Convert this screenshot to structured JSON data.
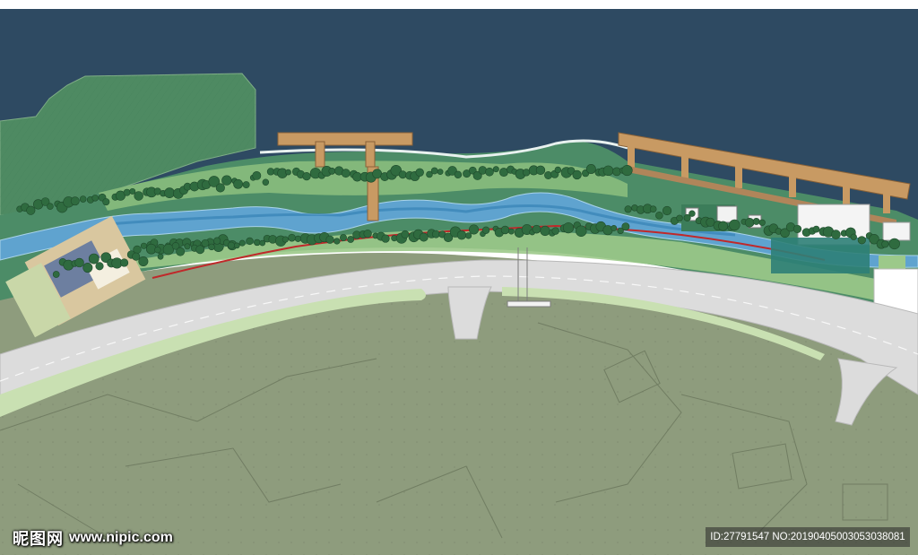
{
  "watermark": {
    "brand": "昵图网",
    "url": "www.nipic.com",
    "id_text": "ID:27791547 NO:20190405003053038081"
  },
  "colors": {
    "water": "#2e4a62",
    "land": "#8e9c7d",
    "park_dark": "#4c8c67",
    "park_light": "#8dbf7f",
    "road": "#dcdcdc",
    "stream": "#5fa3cf",
    "timber": "#c89a63",
    "tree": "#2f6b3f",
    "path_red": "#c0282a"
  }
}
